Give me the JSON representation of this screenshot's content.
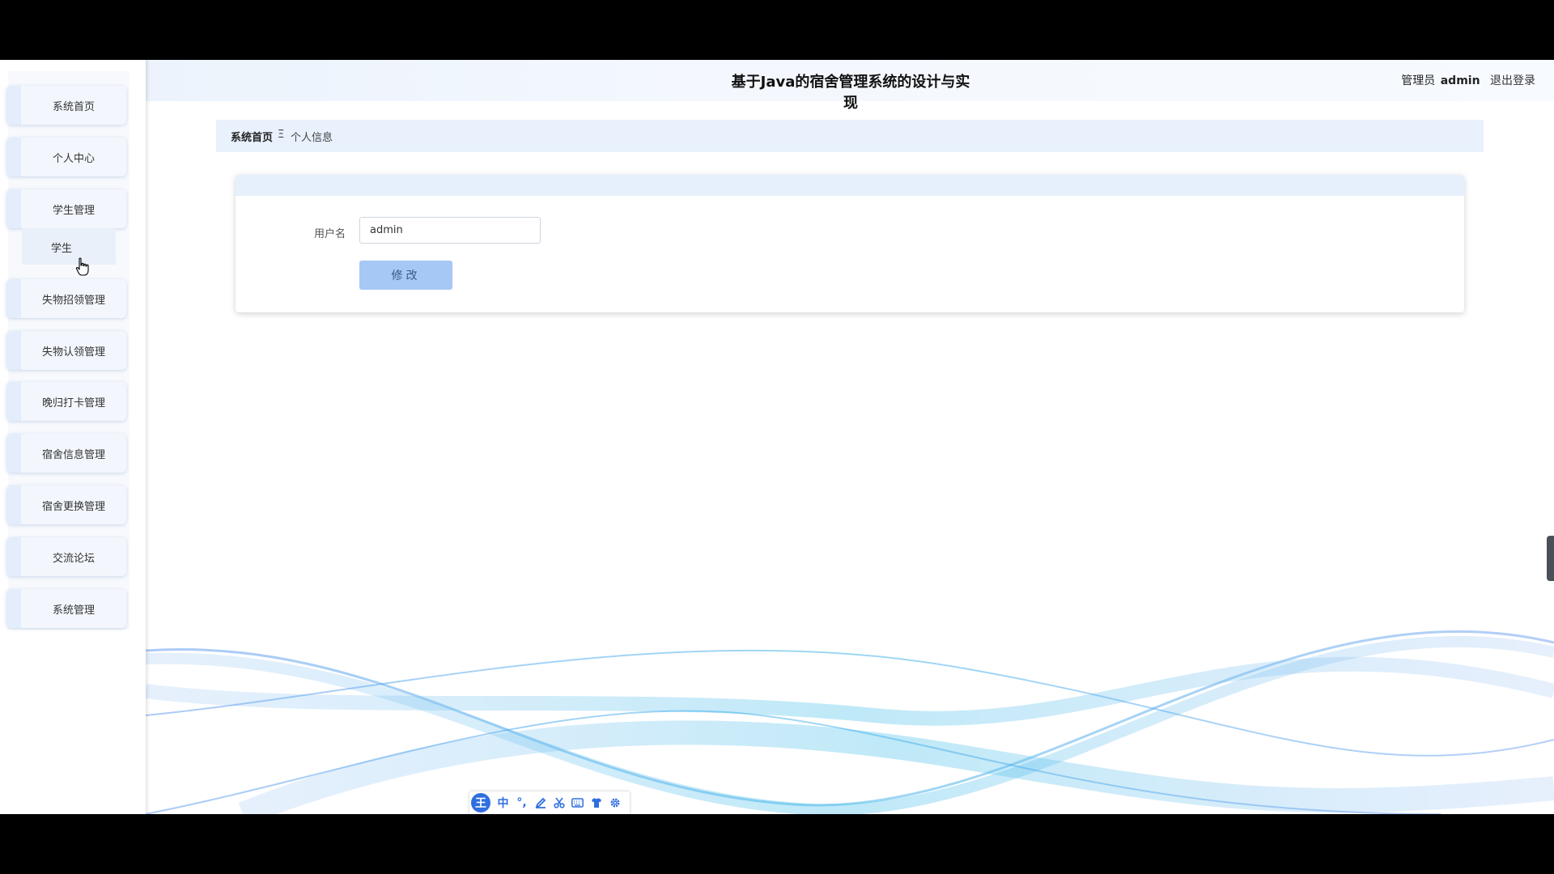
{
  "sidebar": {
    "items": [
      {
        "label": "系统首页"
      },
      {
        "label": "个人中心"
      },
      {
        "label": "学生管理"
      },
      {
        "label": "失物招领管理"
      },
      {
        "label": "失物认领管理"
      },
      {
        "label": "晚归打卡管理"
      },
      {
        "label": "宿舍信息管理"
      },
      {
        "label": "宿舍更换管理"
      },
      {
        "label": "交流论坛"
      },
      {
        "label": "系统管理"
      }
    ],
    "submenu": {
      "label": "学生"
    }
  },
  "header": {
    "title": "基于Java的宿舍管理系统的设计与实现",
    "role": "管理员",
    "username": "admin",
    "logout": "退出登录"
  },
  "breadcrumb": {
    "home": "系统首页",
    "separator": "Ξ",
    "current": "个人信息"
  },
  "form": {
    "username_label": "用户名",
    "username_value": "admin",
    "submit_label": "修改"
  },
  "ime": {
    "logo": "王",
    "icons": [
      "中",
      "°,",
      "pen-icon",
      "scissors-icon",
      "keyboard-icon",
      "shirt-icon",
      "gear-icon"
    ],
    "mode_label": "中",
    "punct_label": "°,"
  },
  "colors": {
    "accent": "#a5c8f5",
    "header_bg": "#ecf3fc",
    "breadcrumb_bg": "#e8f1fc",
    "ime_blue": "#2f6fe0"
  }
}
